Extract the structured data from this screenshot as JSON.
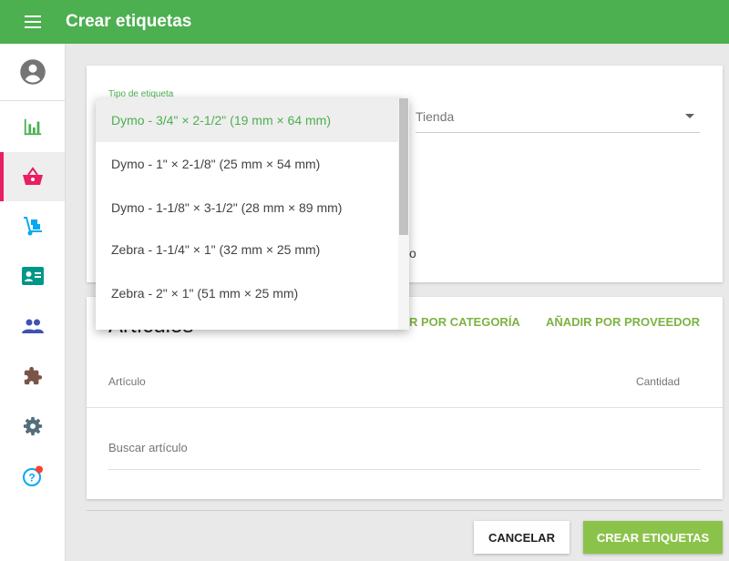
{
  "appbar": {
    "title": "Crear etiquetas",
    "menu_icon": "hamburger-menu-icon"
  },
  "sidebar": {
    "items": [
      {
        "name": "profile",
        "icon": "account-circle-icon",
        "color": "#757575"
      },
      {
        "name": "reports",
        "icon": "bar-chart-icon",
        "color": "#4caf50"
      },
      {
        "name": "sales",
        "icon": "basket-icon",
        "color": "#e91e63",
        "active": true
      },
      {
        "name": "inventory",
        "icon": "hand-truck-icon",
        "color": "#03a9f4"
      },
      {
        "name": "customers",
        "icon": "contact-card-icon",
        "color": "#009688"
      },
      {
        "name": "employees",
        "icon": "people-icon",
        "color": "#3f51b5"
      },
      {
        "name": "integrations",
        "icon": "puzzle-icon",
        "color": "#795548"
      },
      {
        "name": "settings",
        "icon": "gear-icon",
        "color": "#546e7a"
      },
      {
        "name": "help",
        "icon": "help-circle-icon",
        "color": "#03a9f4",
        "badge_color": "#f44336"
      }
    ]
  },
  "label_form": {
    "type_label": "Tipo de etiqueta",
    "store_value": "Tienda",
    "partial_text": "o"
  },
  "dropdown": {
    "options": [
      "Dymo - 3/4\" × 2-1/2\" (19 mm × 64 mm)",
      "Dymo - 1\" × 2-1/8\" (25 mm × 54 mm)",
      "Dymo - 1-1/8\" × 3-1/2\" (28 mm × 89 mm)",
      "Zebra - 1-1/4\" × 1\" (32 mm × 25 mm)",
      "Zebra - 2\" × 1\" (51 mm × 25 mm)"
    ],
    "selected_index": 0
  },
  "articles": {
    "title": "Artículos",
    "add_by_category": "AÑADIR POR CATEGORÍA",
    "add_by_category_visible": "R POR CATEGORÍA",
    "add_by_supplier": "AÑADIR POR PROVEEDOR",
    "col_article": "Artículo",
    "col_quantity": "Cantidad",
    "search_placeholder": "Buscar artículo"
  },
  "footer": {
    "cancel": "CANCELAR",
    "create": "CREAR ETIQUETAS"
  },
  "colors": {
    "primary": "#4caf50",
    "accent_button": "#8bc34a",
    "link": "#7cb342",
    "active_indicator": "#e91e63"
  }
}
